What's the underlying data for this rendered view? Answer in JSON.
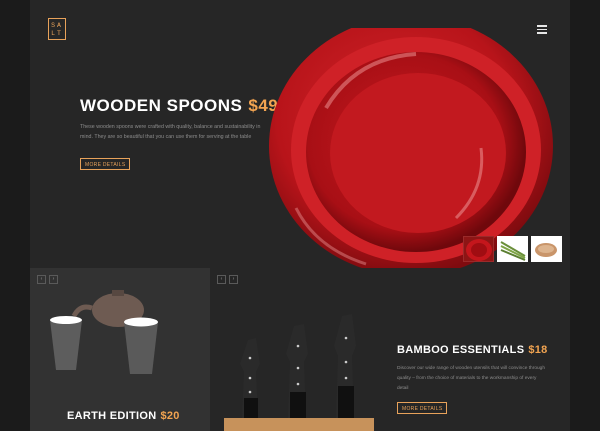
{
  "brand": {
    "logo_text": "SA LT"
  },
  "hero": {
    "title": "WOODEN SPOONS",
    "price": "$49",
    "description": "These wooden spoons were crafted with quality, balance and sustainability in mind. They are so beautiful that you can use them for serving at the table",
    "button_label": "MORE DETAILS",
    "thumbnails": [
      "red-bowls",
      "asparagus",
      "wooden-spoons"
    ]
  },
  "panel_left": {
    "title": "EARTH EDITION",
    "price": "$20",
    "arrows": [
      "‹",
      "›"
    ]
  },
  "panel_right": {
    "title": "BAMBOO ESSENTIALS",
    "price": "$18",
    "description": "Discover our wide range of wooden utensils that will convince through quality – from the choice of materials to the workmanship of every detail",
    "button_label": "MORE DETAILS",
    "arrows": [
      "‹",
      "›"
    ]
  },
  "colors": {
    "accent": "#f2a451",
    "background": "#1e1e1e",
    "plate_red": "#c4161c"
  }
}
